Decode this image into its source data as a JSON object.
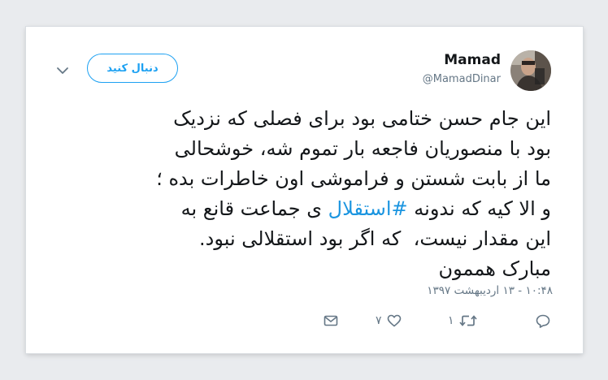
{
  "tweet": {
    "author_name": "Mamad",
    "author_handle": "@MamadDinar",
    "follow_label": "دنبال کنید",
    "text_before_hashtag": "این جام حسن ختامی بود برای فصلی که نزدیک\nبود با منصوریان فاجعه بار تموم شه، خوشحالی\nما از بابت شستن و فراموشی اون خاطرات بده ؛\nو الا کیه که ندونه ",
    "hashtag": "#استقلال",
    "text_after_hashtag": " ی جماعت قانع به\nاین مقدار نیست،  که اگر بود استقلالی نبود.\nمبارک هممون",
    "timestamp": "۱۰:۴۸ - ۱۳ اردیبهشت ۱۳۹۷",
    "retweet_count": "۱",
    "like_count": "۷"
  },
  "icons": {
    "reply": "reply-icon",
    "retweet": "retweet-icon",
    "like": "heart-icon",
    "message": "envelope-icon",
    "caret": "chevron-down-icon"
  },
  "colors": {
    "accent": "#1da1f2",
    "hashtag": "#1b95e0",
    "text": "#14171a",
    "muted": "#657786"
  }
}
